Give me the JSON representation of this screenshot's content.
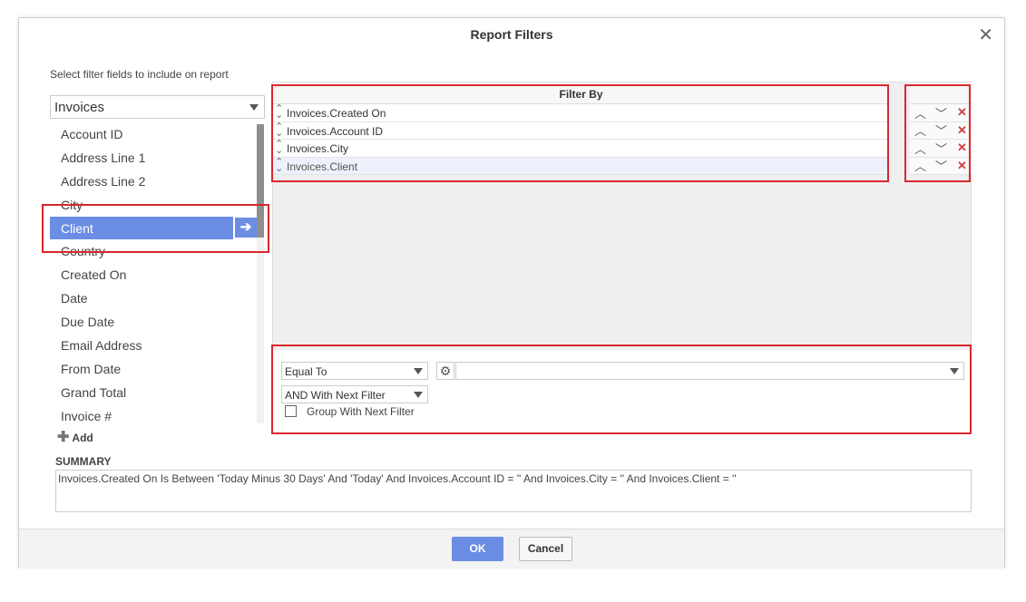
{
  "dialog": {
    "title": "Report Filters",
    "close_glyph": "✕",
    "instruction": "Select filter fields to include on report"
  },
  "datasource": {
    "value": "Invoices"
  },
  "fields": [
    {
      "label": "Account ID"
    },
    {
      "label": "Address Line 1"
    },
    {
      "label": "Address Line 2"
    },
    {
      "label": "City"
    },
    {
      "label": "Client",
      "selected": true
    },
    {
      "label": "Country"
    },
    {
      "label": "Created On"
    },
    {
      "label": "Date"
    },
    {
      "label": "Due Date"
    },
    {
      "label": "Email Address"
    },
    {
      "label": "From Date"
    },
    {
      "label": "Grand Total"
    },
    {
      "label": "Invoice #"
    }
  ],
  "add_field_button": {
    "label": "Add",
    "arrow_glyph": "➔"
  },
  "filter_grid": {
    "header": "Filter By",
    "rows": [
      {
        "label": "Invoices.Created On"
      },
      {
        "label": "Invoices.Account ID"
      },
      {
        "label": "Invoices.City"
      },
      {
        "label": "Invoices.Client",
        "active": true
      }
    ]
  },
  "row_actions": {
    "up_icon": "chevron-up-icon",
    "down_icon": "chevron-down-icon",
    "delete_icon": "close-icon"
  },
  "filter_options": {
    "operator": "Equal To",
    "value": "",
    "logic": "AND With Next Filter",
    "group_label": "Group With Next Filter",
    "group_checked": false
  },
  "summary": {
    "label": "SUMMARY",
    "text": "Invoices.Created On Is Between 'Today Minus 30 Days' And 'Today' And Invoices.Account ID = '' And Invoices.City = '' And Invoices.Client = ''"
  },
  "footer": {
    "ok_label": "OK",
    "cancel_label": "Cancel"
  },
  "colors": {
    "accent": "#6b8de3",
    "highlight": "#d9272e",
    "delete": "#d43c3c"
  }
}
